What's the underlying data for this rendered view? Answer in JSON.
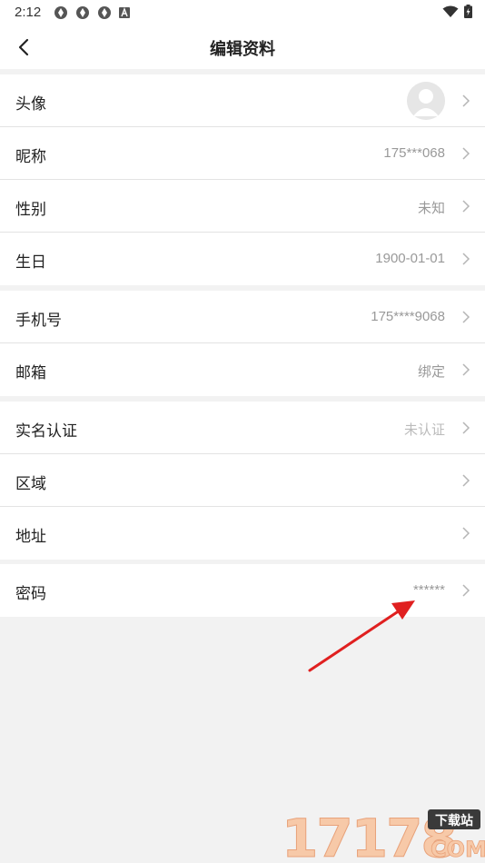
{
  "status_bar": {
    "time": "2:12"
  },
  "nav": {
    "title": "编辑资料"
  },
  "groups": [
    {
      "rows": [
        {
          "label": "头像",
          "value": ""
        },
        {
          "label": "昵称",
          "value": "175***068"
        },
        {
          "label": "性别",
          "value": "未知"
        },
        {
          "label": "生日",
          "value": "1900-01-01"
        }
      ]
    },
    {
      "rows": [
        {
          "label": "手机号",
          "value": "175****9068"
        },
        {
          "label": "邮箱",
          "value": "绑定"
        }
      ]
    },
    {
      "rows": [
        {
          "label": "实名认证",
          "value": "未认证"
        },
        {
          "label": "区域",
          "value": ""
        },
        {
          "label": "地址",
          "value": ""
        }
      ]
    },
    {
      "rows": [
        {
          "label": "密码",
          "value": "******"
        }
      ]
    }
  ],
  "watermark": {
    "number": "17178",
    "tag": "下载站",
    "domain": "COM"
  },
  "colors": {
    "annotation_arrow": "#e02020",
    "watermark": "#f7c9a8",
    "watermark_tag": "#3a3a3a"
  }
}
